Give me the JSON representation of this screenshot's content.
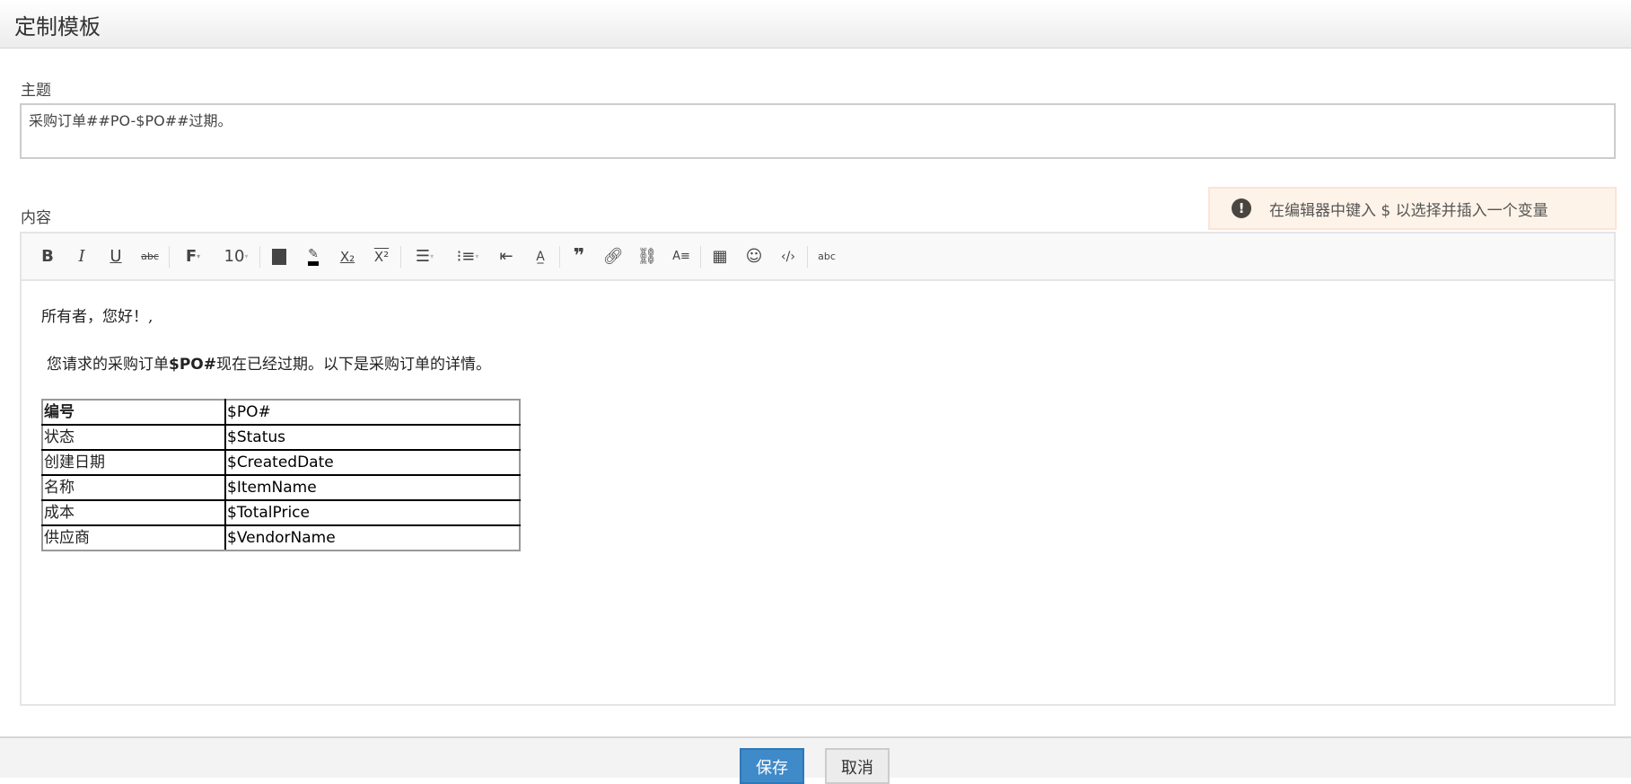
{
  "header": {
    "title": "定制模板"
  },
  "subject": {
    "label": "主题",
    "value": "采购订单##PO-$PO##过期。"
  },
  "content": {
    "label": "内容"
  },
  "notice": {
    "icon": "exclamation-circle-icon",
    "text": "在编辑器中键入 $ 以选择并插入一个变量"
  },
  "toolbar": {
    "bold": "B",
    "italic": "I",
    "underline": "U",
    "strike": "abc",
    "font": "F",
    "font_size": "10",
    "subscript": "X₂",
    "superscript": "X²",
    "quote": "❞",
    "spell": "abc"
  },
  "editor": {
    "greeting": "所有者，您好！,",
    "body_prefix": "您请求的采购订单",
    "body_var": "$PO#",
    "body_suffix": "现在已经过期。以下是采购订单的详情。",
    "table": [
      {
        "k": "编号",
        "v": "$PO#"
      },
      {
        "k": "状态",
        "v": "$Status"
      },
      {
        "k": "创建日期",
        "v": "$CreatedDate"
      },
      {
        "k": "名称",
        "v": "$ItemName"
      },
      {
        "k": "成本",
        "v": "$TotalPrice"
      },
      {
        "k": "供应商",
        "v": "$VendorName"
      }
    ]
  },
  "footer": {
    "save": "保存",
    "cancel": "取消"
  }
}
